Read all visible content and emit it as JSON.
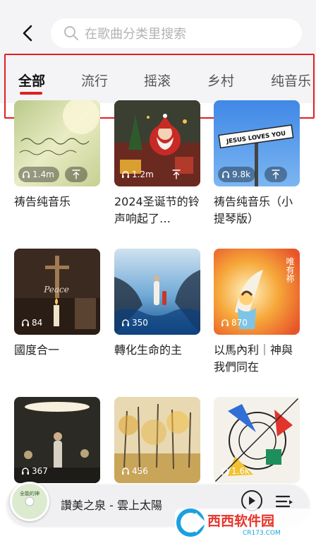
{
  "search": {
    "placeholder": "在歌曲分类里搜索"
  },
  "tabs": [
    {
      "label": "全部",
      "active": true
    },
    {
      "label": "流行",
      "active": false
    },
    {
      "label": "摇滚",
      "active": false
    },
    {
      "label": "乡村",
      "active": false
    },
    {
      "label": "纯音乐",
      "active": false
    }
  ],
  "playlists": [
    {
      "title": "祷告纯音乐",
      "plays": "1.4m",
      "art": "handwriting-sunlight"
    },
    {
      "title": "2024圣诞节的铃声响起了…",
      "plays": "1.2m",
      "art": "santa-claus"
    },
    {
      "title": "祷告纯音乐（小提琴版）",
      "plays": "9.8k",
      "art": "road-sign",
      "art_text": "JESUS LOVES YOU"
    },
    {
      "title": "國度合一",
      "plays": "84",
      "art": "candle-cross",
      "art_text": "Peace"
    },
    {
      "title": "轉化生命的主",
      "plays": "350",
      "art": "waves-figure"
    },
    {
      "title": "以馬內利｜神與我們同在",
      "plays": "870",
      "art": "hands-light",
      "art_text": "唯有祢"
    },
    {
      "title": "",
      "plays": "367",
      "art": "stage-spotlight"
    },
    {
      "title": "",
      "plays": "456",
      "art": "autumn-trees"
    },
    {
      "title": "",
      "plays": "1.6k",
      "art": "geometric-shapes"
    }
  ],
  "player": {
    "track": "讚美之泉 - 雲上太陽",
    "disc_text": "全能的神"
  },
  "watermark": {
    "brand": "西西软件园",
    "domain": "CR173.COM"
  },
  "colors": {
    "accent": "#e02020",
    "highlight_box": "#e02020",
    "background": "#f4f4f6"
  }
}
